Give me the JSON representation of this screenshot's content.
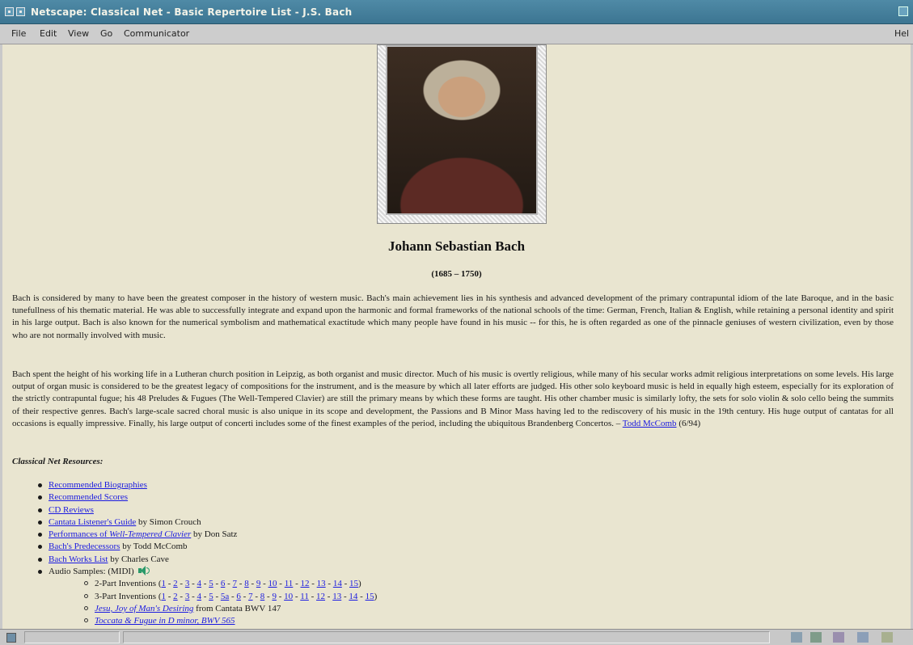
{
  "window": {
    "title": "Netscape: Classical Net - Basic Repertoire List - J.S. Bach"
  },
  "menu": {
    "file": "File",
    "edit": "Edit",
    "view": "View",
    "go": "Go",
    "communicator": "Communicator",
    "help": "Hel"
  },
  "page": {
    "title": "Johann Sebastian Bach",
    "dates": "(1685 – 1750)",
    "para1": "Bach is considered by many to have been the greatest composer in the history of western music. Bach's main achievement lies in his synthesis and advanced development of the primary contrapuntal idiom of the late Baroque, and in the basic tunefullness of his thematic material. He was able to successfully integrate and expand upon the harmonic and formal frameworks of the national schools of the time: German, French, Italian & English, while retaining a personal identity and spirit in his large output. Bach is also known for the numerical symbolism and mathematical exactitude which many people have found in his music -- for this, he is often regarded as one of the pinnacle geniuses of western civilization, even by those who are not normally involved with music.",
    "para2": "Bach spent the height of his working life in a Lutheran church position in Leipzig, as both organist and music director. Much of his music is overtly religious, while many of his secular works admit religious interpretations on some levels. His large output of organ music is considered to be the greatest legacy of compositions for the instrument, and is the measure by which all later efforts are judged. His other solo keyboard music is held in equally high esteem, especially for its exploration of the strictly contrapuntal fugue; his 48 Preludes & Fugues (The Well-Tempered Clavier) are still the primary means by which these forms are taught. His other chamber music is similarly lofty, the sets for solo violin & solo cello being the summits of their respective genres. Bach's large-scale sacred choral music is also unique in its scope and development, the Passions and B Minor Mass having led to the rediscovery of his music in the 19th century. His huge output of cantatas for all occasions is equally impressive. Finally, his large output of concerti includes some of the finest examples of the period, including the ubiquitous Brandenberg Concertos. –",
    "para2_author": "Todd McComb",
    "para2_date": "(6/94)",
    "resources_heading": "Classical Net Resources:",
    "resources": {
      "bios": "Recommended Biographies",
      "scores": "Recommended Scores",
      "cd": "CD Reviews",
      "cantata": "Cantata Listener's Guide",
      "cantata_by": "by Simon Crouch",
      "wtc_prefix": "Performances of ",
      "wtc_italic": "Well-Tempered Clavier",
      "wtc_by": "by Don Satz",
      "pred": "Bach's Predecessors",
      "pred_by": "by Todd McComb",
      "works": "Bach Works List",
      "works_by": "by Charles Cave",
      "audio": "Audio Samples: (MIDI)",
      "two_part_label": "2-Part Inventions",
      "two_part_links": [
        "1",
        "2",
        "3",
        "4",
        "5",
        "6",
        "7",
        "8",
        "9",
        "10",
        "11",
        "12",
        "13",
        "14",
        "15"
      ],
      "three_part_label": "3-Part Inventions",
      "three_part_links": [
        "1",
        "2",
        "3",
        "4",
        "5",
        "5a",
        "6",
        "7",
        "8",
        "9",
        "10",
        "11",
        "12",
        "13",
        "14",
        "15"
      ],
      "jesu_link": "Jesu, Joy of Man's Desiring",
      "jesu_suffix": "from Cantata BWV 147",
      "toccata": "Toccata & Fugue in D minor, BWV 565"
    }
  }
}
